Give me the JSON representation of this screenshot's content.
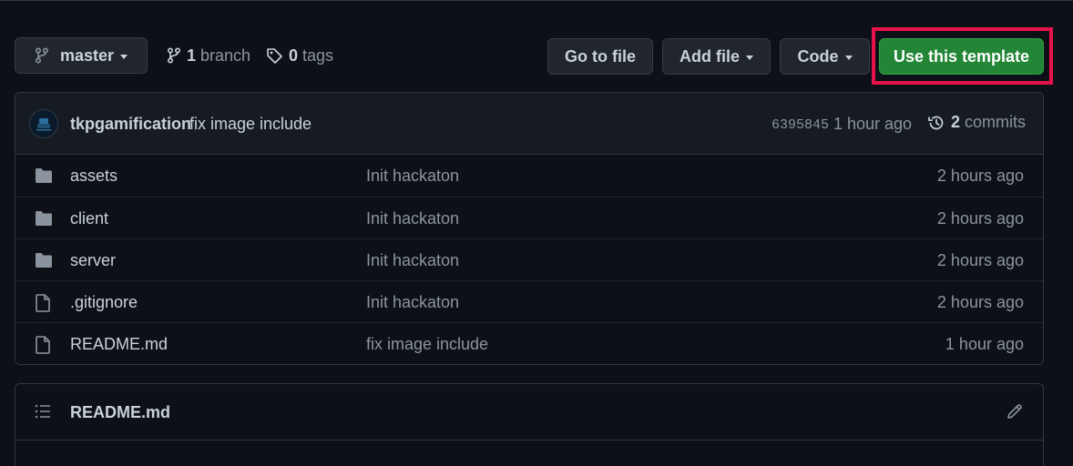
{
  "toolbar": {
    "branch_name": "master",
    "branch_count": "1",
    "branch_label": "branch",
    "tag_count": "0",
    "tag_label": "tags",
    "goto_file_label": "Go to file",
    "add_file_label": "Add file",
    "code_label": "Code",
    "use_template_label": "Use this template"
  },
  "latest_commit": {
    "author": "tkpgamification",
    "message": "fix image include",
    "sha": "6395845",
    "time": "1 hour ago",
    "commit_count": "2",
    "commit_label": "commits"
  },
  "files": [
    {
      "type": "folder",
      "name": "assets",
      "message": "Init hackaton",
      "time": "2 hours ago"
    },
    {
      "type": "folder",
      "name": "client",
      "message": "Init hackaton",
      "time": "2 hours ago"
    },
    {
      "type": "folder",
      "name": "server",
      "message": "Init hackaton",
      "time": "2 hours ago"
    },
    {
      "type": "file",
      "name": ".gitignore",
      "message": "Init hackaton",
      "time": "2 hours ago"
    },
    {
      "type": "file",
      "name": "README.md",
      "message": "fix image include",
      "time": "1 hour ago"
    }
  ],
  "readme": {
    "title": "README.md"
  },
  "colors": {
    "background": "#0d1117",
    "primary_button": "#238636",
    "highlight": "#e8124a",
    "icon": "#8b949e"
  },
  "icons": {
    "branch": "git-branch-icon",
    "tag": "tag-icon",
    "history": "history-icon",
    "folder": "folder-icon",
    "file": "file-icon",
    "list": "list-icon",
    "edit": "pencil-icon"
  }
}
